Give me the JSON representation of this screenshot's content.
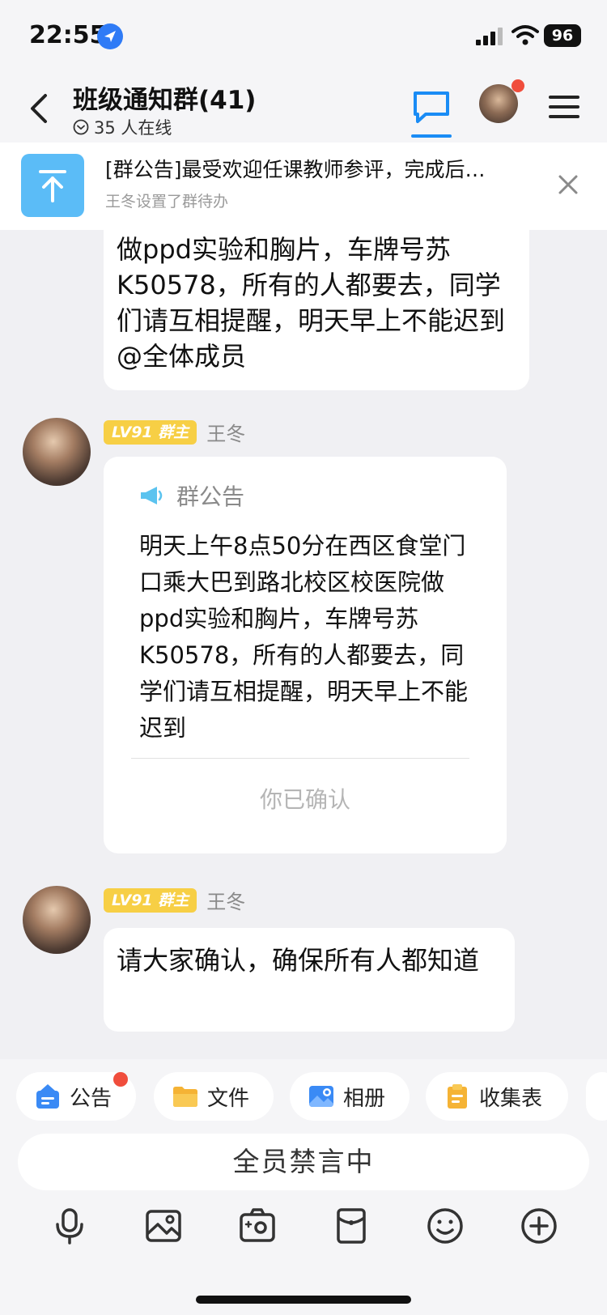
{
  "status_bar": {
    "time": "22:55",
    "battery": "96"
  },
  "header": {
    "title": "班级通知群(41)",
    "online": "35 人在线"
  },
  "pinned": {
    "title": "[群公告]最受欢迎任课教师参评，完成后…",
    "subtitle": "王冬设置了群待办"
  },
  "messages": {
    "partial_text": "做ppd实验和胸片，车牌号苏K50578，所有的人都要去，同学们请互相提醒，明天早上不能迟到@全体成员",
    "notice_msg": {
      "badge": "LV91 群主",
      "sender": "王冬",
      "label": "群公告",
      "body": "明天上午8点50分在西区食堂门口乘大巴到路北校区校医院做ppd实验和胸片，车牌号苏K50578，所有的人都要去，同学们请互相提醒，明天早上不能迟到",
      "status": "你已确认"
    },
    "text_msg": {
      "badge": "LV91 群主",
      "sender": "王冬",
      "text": "请大家确认，确保所有人都知道"
    }
  },
  "toolbar": {
    "chips": [
      "公告",
      "文件",
      "相册",
      "收集表"
    ]
  },
  "input": {
    "muted": "全员禁言中"
  },
  "icons": [
    "location-icon",
    "signal-icon",
    "wifi-icon",
    "back-icon",
    "chat-icon",
    "menu-icon",
    "pin-up-icon",
    "close-icon",
    "megaphone-icon",
    "notice-icon",
    "folder-icon",
    "album-icon",
    "form-icon",
    "mic-icon",
    "image-icon",
    "camera-icon",
    "redpacket-icon",
    "emoji-icon",
    "plus-icon"
  ],
  "colors": {
    "accent": "#1a8cf5",
    "badge": "#f7cf45",
    "pinned_icon": "#5bbcf7",
    "dot": "#f04d3c"
  }
}
